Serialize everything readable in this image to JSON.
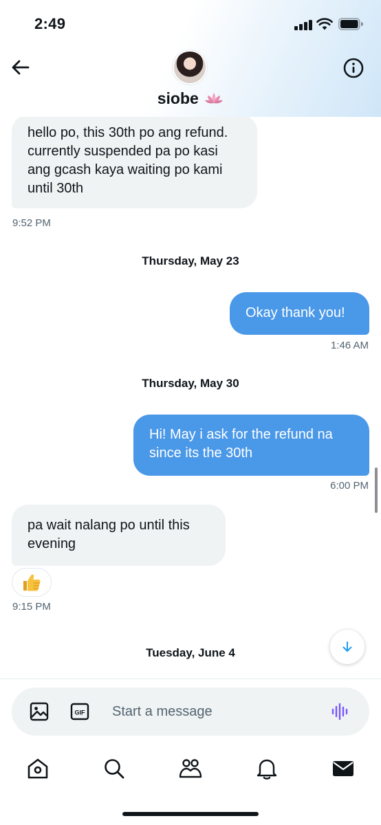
{
  "status_bar": {
    "time": "2:49"
  },
  "header": {
    "contact_name": "siobe",
    "name_emoji_icon": "lotus-icon"
  },
  "messages": [
    {
      "direction": "incoming",
      "text": "hello po, this 30th po ang refund. currently suspended pa po kasi ang gcash kaya waiting po kami until 30th",
      "time": "9:52 PM"
    },
    {
      "direction": "outgoing",
      "text": "Okay thank you!",
      "time": "1:46 AM"
    },
    {
      "direction": "outgoing",
      "text": "Hi! May i ask for the refund na since its the 30th",
      "time": "6:00 PM"
    },
    {
      "direction": "incoming",
      "text": "pa wait nalang po until this evening",
      "time": "9:15 PM",
      "reaction": "thumbs-up"
    }
  ],
  "date_separators": [
    "Thursday, May 23",
    "Thursday, May 30",
    "Tuesday, June 4"
  ],
  "composer": {
    "placeholder": "Start a message"
  },
  "tabbar": {
    "items": [
      "home-icon",
      "search-icon",
      "communities-icon",
      "notifications-icon",
      "messages-icon"
    ]
  },
  "colors": {
    "accent": "#1d9bf0",
    "outgoing_bubble": "#4a98e8",
    "incoming_bubble": "#eff3f4",
    "voice_icon": "#7856ff"
  }
}
